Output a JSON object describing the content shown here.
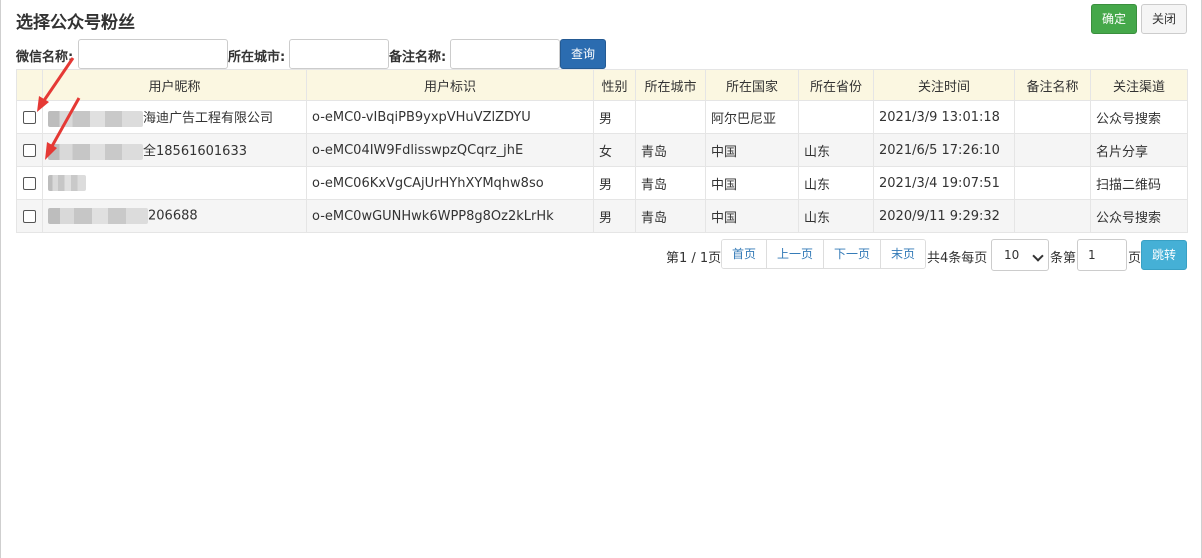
{
  "dialog": {
    "title": "选择公众号粉丝",
    "ok_label": "确定",
    "close_label": "关闭"
  },
  "filters": {
    "wechat_name_label": "微信名称:",
    "city_label": "所在城市:",
    "remark_label": "备注名称:",
    "query_label": "查询",
    "wechat_name_value": "",
    "city_value": "",
    "remark_value": ""
  },
  "table": {
    "headers": [
      "",
      "用户昵称",
      "用户标识",
      "性别",
      "所在城市",
      "所在国家",
      "所在省份",
      "关注时间",
      "备注名称",
      "关注渠道"
    ],
    "rows": [
      {
        "nickname": "海迪广告工程有限公司",
        "openid": "o-eMC0-vIBqiPB9yxpVHuVZlZDYU",
        "gender": "男",
        "city": "",
        "country": "阿尔巴尼亚",
        "province": "",
        "time": "2021/3/9 13:01:18",
        "remark": "",
        "channel": "公众号搜索"
      },
      {
        "nickname": "全18561601633",
        "openid": "o-eMC04IW9FdlisswpzQCqrz_jhE",
        "gender": "女",
        "city": "青岛",
        "country": "中国",
        "province": "山东",
        "time": "2021/6/5 17:26:10",
        "remark": "",
        "channel": "名片分享"
      },
      {
        "nickname": "",
        "openid": "o-eMC06KxVgCAjUrHYhXYMqhw8so",
        "gender": "男",
        "city": "青岛",
        "country": "中国",
        "province": "山东",
        "time": "2021/3/4 19:07:51",
        "remark": "",
        "channel": "扫描二维码"
      },
      {
        "nickname": "206688",
        "openid": "o-eMC0wGUNHwk6WPP8g8Oz2kLrHk",
        "gender": "男",
        "city": "青岛",
        "country": "中国",
        "province": "山东",
        "time": "2020/9/11 9:29:32",
        "remark": "",
        "channel": "公众号搜索"
      }
    ]
  },
  "pagination": {
    "page_info": "第1 / 1页",
    "first": "首页",
    "prev": "上一页",
    "next": "下一页",
    "last": "末页",
    "total_text": "共4条每页",
    "page_size": "10",
    "goto_prefix": "条第",
    "goto_value": "1",
    "goto_suffix": "页",
    "jump_label": "跳转"
  },
  "colors": {
    "ok": "#45a84a",
    "query": "#2b6cb0",
    "jump": "#45b0d6",
    "header_bg": "#fbf7e1",
    "arrow": "#e53935"
  }
}
